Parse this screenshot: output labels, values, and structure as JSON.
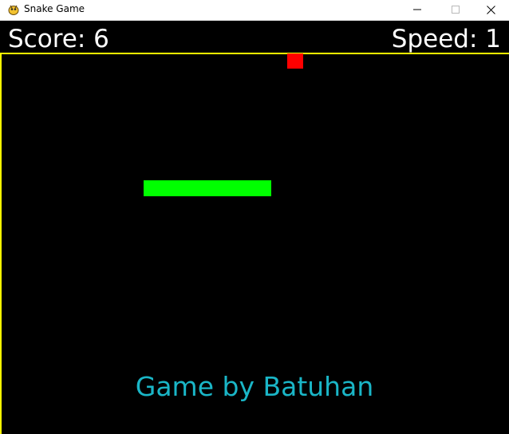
{
  "window": {
    "title": "Snake Game",
    "app_icon": "pygame-snake-icon",
    "controls": [
      "minimize-icon",
      "maximize-icon",
      "close-icon"
    ]
  },
  "hud": {
    "score_text": "Score: 6",
    "speed_text": "Speed: 1",
    "score": 6,
    "speed": 1
  },
  "game": {
    "snake_length": 8,
    "snake_color": "#00ff00",
    "food_color": "#ff0000",
    "border_color": "#ffff00",
    "background_color": "#000000"
  },
  "credit_text": "Game by Batuhan",
  "credit_color": "#1ab6c7"
}
